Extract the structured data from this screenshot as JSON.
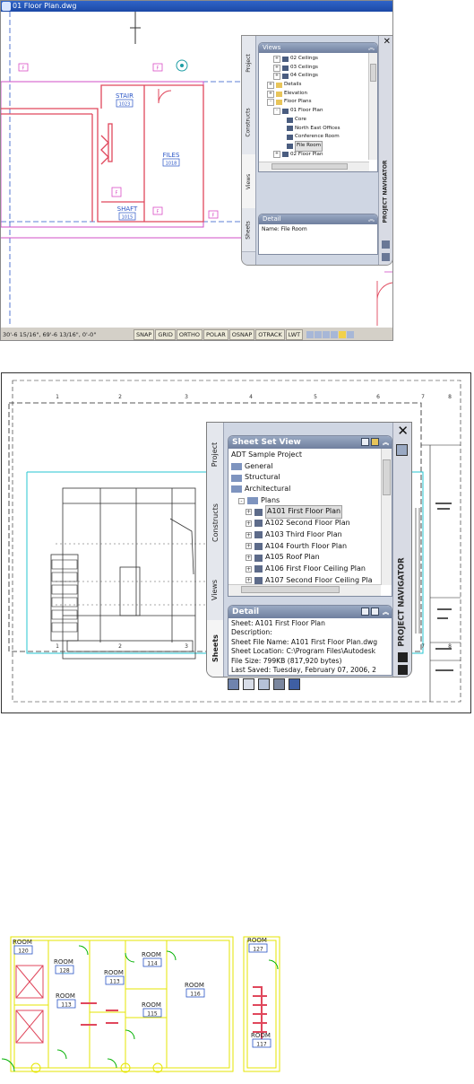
{
  "top_screenshot": {
    "window_title": "01 Floor Plan.dwg",
    "rooms": {
      "stair": {
        "name": "STAIR",
        "number": "1023"
      },
      "files": {
        "name": "FILES",
        "number": "1018"
      },
      "shaft": {
        "name": "SHAFT",
        "number": "1015"
      }
    },
    "tag_letter": "F",
    "navigator": {
      "title": "PROJECT NAVIGATOR",
      "tabs": [
        "Project",
        "Constructs",
        "Views",
        "Sheets"
      ],
      "active_tab": "Views",
      "views_header": "Views",
      "tree": [
        {
          "label": "02 Ceilings",
          "indent": 2,
          "expander": "+",
          "icon": "view"
        },
        {
          "label": "03 Ceilings",
          "indent": 2,
          "expander": "+",
          "icon": "view"
        },
        {
          "label": "04 Ceilings",
          "indent": 2,
          "expander": "+",
          "icon": "view"
        },
        {
          "label": "Details",
          "indent": 1,
          "expander": "+",
          "icon": "folder"
        },
        {
          "label": "Elevation",
          "indent": 1,
          "expander": "+",
          "icon": "folder"
        },
        {
          "label": "Floor Plans",
          "indent": 1,
          "expander": "-",
          "icon": "folder"
        },
        {
          "label": "01 Floor Plan",
          "indent": 2,
          "expander": "-",
          "icon": "view"
        },
        {
          "label": "Core",
          "indent": 3,
          "expander": "",
          "icon": "view"
        },
        {
          "label": "North East Offices",
          "indent": 3,
          "expander": "",
          "icon": "view"
        },
        {
          "label": "Conference Room",
          "indent": 3,
          "expander": "",
          "icon": "view"
        },
        {
          "label": "File Room",
          "indent": 3,
          "expander": "",
          "icon": "view",
          "selected": true
        },
        {
          "label": "02 Floor Plan",
          "indent": 2,
          "expander": "+",
          "icon": "view"
        }
      ],
      "detail_header": "Detail",
      "detail_text": "Name: File Room"
    },
    "status": {
      "coordinates": "30'-6 15/16\", 69'-6 13/16\", 0'-0\"",
      "buttons": [
        "SNAP",
        "GRID",
        "ORTHO",
        "POLAR",
        "OSNAP",
        "OTRACK",
        "LWT"
      ]
    }
  },
  "middle_screenshot": {
    "column_numbers": [
      "1",
      "2",
      "3",
      "4",
      "5",
      "6",
      "7",
      "8"
    ],
    "navigator": {
      "title": "PROJECT NAVIGATOR",
      "tabs": [
        "Project",
        "Constructs",
        "Views",
        "Sheets"
      ],
      "active_tab": "Sheets",
      "sheet_set_header": "Sheet Set View",
      "tree": [
        {
          "label": "ADT Sample Project",
          "indent": 0,
          "expander": "",
          "icon": "none"
        },
        {
          "label": "General",
          "indent": 0,
          "expander": "",
          "icon": "folder"
        },
        {
          "label": "Structural",
          "indent": 0,
          "expander": "",
          "icon": "folder"
        },
        {
          "label": "Architectural",
          "indent": 0,
          "expander": "",
          "icon": "folder"
        },
        {
          "label": "Plans",
          "indent": 1,
          "expander": "-",
          "icon": "folder"
        },
        {
          "label": "A101 First Floor Plan",
          "indent": 2,
          "expander": "+",
          "icon": "sheet",
          "selected": true
        },
        {
          "label": "A102 Second Floor Plan",
          "indent": 2,
          "expander": "+",
          "icon": "sheet"
        },
        {
          "label": "A103 Third Floor Plan",
          "indent": 2,
          "expander": "+",
          "icon": "sheet"
        },
        {
          "label": "A104 Fourth Floor Plan",
          "indent": 2,
          "expander": "+",
          "icon": "sheet"
        },
        {
          "label": "A105 Roof Plan",
          "indent": 2,
          "expander": "+",
          "icon": "sheet"
        },
        {
          "label": "A106 First Floor Ceiling Plan",
          "indent": 2,
          "expander": "+",
          "icon": "sheet"
        },
        {
          "label": "A107 Second Floor Ceiling Pla",
          "indent": 2,
          "expander": "+",
          "icon": "sheet"
        }
      ],
      "detail_header": "Detail",
      "detail_lines": [
        "Sheet: A101 First Floor Plan",
        "Description:",
        "Sheet File Name: A101 First Floor Plan.dwg",
        "Sheet Location: C:\\Program Files\\Autodesk",
        "File Size: 799KB (817,920 bytes)",
        "Last Saved: Tuesday, February 07, 2006, 2"
      ]
    }
  },
  "bottom_plan": {
    "room_label": "ROOM",
    "rooms": [
      {
        "id": "r120",
        "name": "ROOM",
        "number": "120"
      },
      {
        "id": "r128",
        "name": "ROOM",
        "number": "128"
      },
      {
        "id": "r113b",
        "name": "ROOM",
        "number": "113"
      },
      {
        "id": "r113",
        "name": "ROOM",
        "number": "113"
      },
      {
        "id": "r114",
        "name": "ROOM",
        "number": "114"
      },
      {
        "id": "r115",
        "name": "ROOM",
        "number": "115"
      },
      {
        "id": "r116",
        "name": "ROOM",
        "number": "116"
      },
      {
        "id": "r127",
        "name": "ROOM",
        "number": "127"
      },
      {
        "id": "r117",
        "name": "ROOM",
        "number": "117"
      }
    ]
  },
  "colors": {
    "title_bar": "#1c49a6",
    "panel_bg": "#cfd6e3",
    "pane_header": "#6f7f9e",
    "wall_red": "#e0475c",
    "wall_magenta": "#d24fc7",
    "grid_blue": "#2a55c6",
    "tag_magenta": "#d94ec5",
    "cyan_line": "#26c6d0",
    "plan_yellow": "#e6e600",
    "door_green": "#00b000"
  }
}
